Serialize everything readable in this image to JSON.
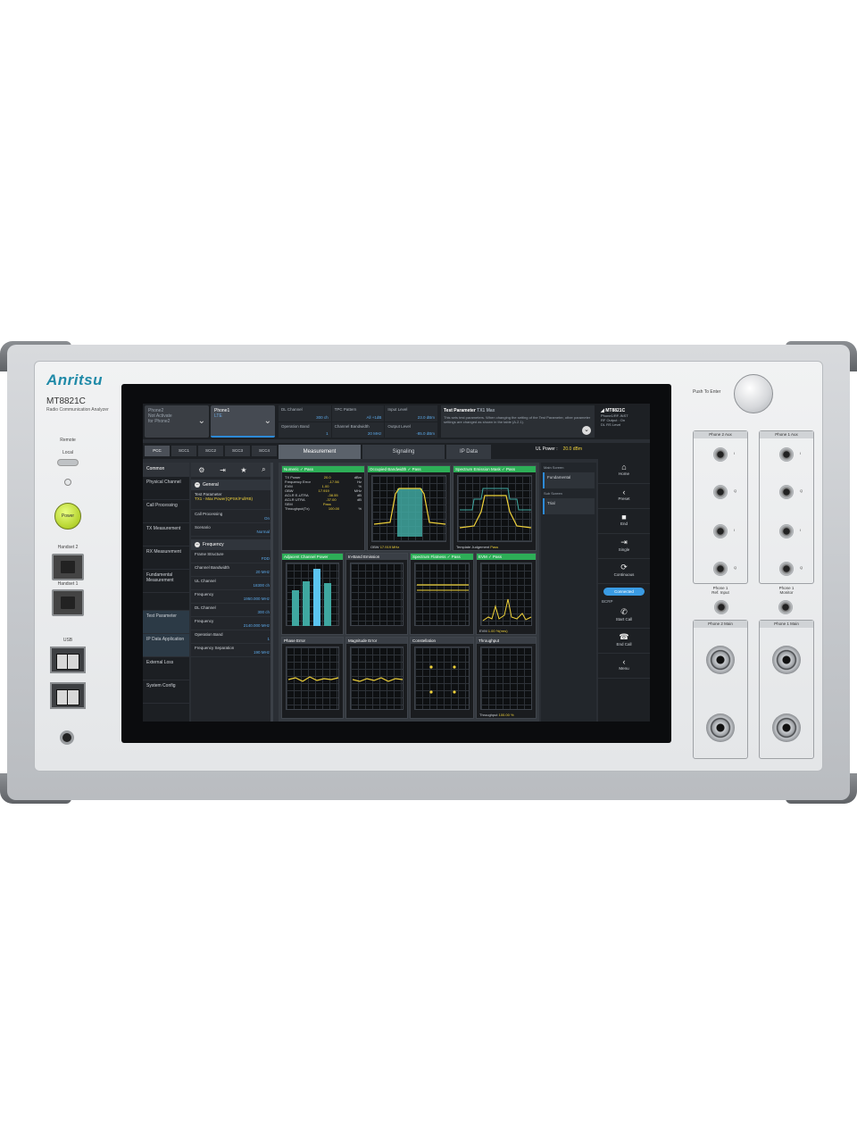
{
  "device": {
    "brand": "Anritsu",
    "model": "MT8821C",
    "subtitle": "Radio Communication Analyzer",
    "remote_label": "Remote",
    "local_label": "Local",
    "power_label": "Power",
    "handset1_label": "Handset 1",
    "handset2_label": "Handset 2",
    "usb_label": "USB",
    "knob_label": "Push To\nEnter"
  },
  "screen": {
    "phones": [
      {
        "name": "Phone2",
        "sub1": "Not Activate",
        "sub2": "for Phone2"
      },
      {
        "name": "Phone1",
        "sub1": "LTE",
        "sub2": ""
      }
    ],
    "params": [
      {
        "label": "DL Channel",
        "value": "300 ch"
      },
      {
        "label": "TPC Pattern",
        "value": "All +1dB"
      },
      {
        "label": "Input Level",
        "value": "23.0 dBm"
      },
      {
        "label": "Operation Band",
        "value": "1"
      },
      {
        "label": "Channel Bandwidth",
        "value": "20 MHz"
      },
      {
        "label": "Output Level",
        "value": "-85.0 dBm"
      }
    ],
    "test_param": {
      "title": "Test Parameter",
      "name": "TX1 Max",
      "desc": "This sets test parameters. When changing the setting of the Test Parameter, other parameter settings are changed as shown in the table (A.2.1)."
    },
    "instrument": {
      "title": "MT8821C",
      "lines": [
        "Phone1/RF-INST",
        "RF Output : On",
        "DL RS Level"
      ]
    },
    "cc_tabs": [
      "PCC",
      "SCC1",
      "SCC2",
      "SCC3",
      "SCC4"
    ],
    "main_tabs": [
      "Measurement",
      "Signaling",
      "IP Data"
    ],
    "ul_power": {
      "label": "UL Power :",
      "value": "20.0 dBm"
    },
    "left_nav": {
      "header": "Common",
      "items": [
        "Physical Channel",
        "Call Processing",
        "TX Measurement",
        "RX Measurement",
        "Fundamental Measurement",
        "",
        "Test Parameter",
        "IP Data Application",
        "External Loss",
        "System Config"
      ]
    },
    "settings": {
      "icons": [
        "wrench-icon",
        "import-icon",
        "star-icon",
        "search-icon"
      ],
      "general": {
        "title": "General",
        "rows": [
          {
            "label": "Test Parameter",
            "value": "TX1 - Max Power(QPSK/FullRB)",
            "highlight": true
          },
          {
            "label": "Call Processing",
            "value": "On",
            "highlight": false
          },
          {
            "label": "Scenario",
            "value": "Normal",
            "highlight": false
          }
        ]
      },
      "frequency": {
        "title": "Frequency",
        "rows": [
          {
            "label": "Frame Structure",
            "value": "FDD"
          },
          {
            "label": "Channel Bandwidth",
            "value": "20 MHz"
          },
          {
            "label": "UL Channel",
            "value": "18300 ch"
          },
          {
            "label": "Frequency",
            "value": "1950.000 MHz"
          },
          {
            "label": "DL Channel",
            "value": "300 ch"
          },
          {
            "label": "Frequency",
            "value": "2140.000 MHz"
          },
          {
            "label": "Operation Band",
            "value": "1"
          },
          {
            "label": "Frequency Separation",
            "value": "190 MHz"
          }
        ]
      }
    },
    "panels": [
      {
        "title": "Numeric",
        "status": "✓ Pass",
        "green": true
      },
      {
        "title": "Occupied Bandwidth",
        "status": "✓ Pass",
        "green": true,
        "footer": "OBW",
        "footer_value": "17.919 MHz"
      },
      {
        "title": "Spectrum Emission Mask",
        "status": "✓ Pass",
        "green": true,
        "footer": "Template Judgement",
        "footer_value": "Pass"
      },
      {
        "title": "Adjacent Channel Power",
        "status": "✓ Pass",
        "green": true
      },
      {
        "title": "In-Band Emission",
        "status": "",
        "green": false
      },
      {
        "title": "Spectrum Flatness",
        "status": "✓ Pass",
        "green": true
      },
      {
        "title": "EVM",
        "status": "✓ Pass",
        "green": true,
        "footer": "EVM",
        "footer_value": "1.00 %(rms)"
      },
      {
        "title": "Phase Error",
        "status": "",
        "green": false
      },
      {
        "title": "Magnitude Error",
        "status": "",
        "green": false
      },
      {
        "title": "Constellation",
        "status": "",
        "green": false
      },
      {
        "title": "Throughput",
        "status": "",
        "green": false,
        "footer": "Throughput",
        "footer_value": "100.00 %"
      }
    ],
    "numeric_table": [
      [
        "TX Power",
        "20.0",
        "dBm"
      ],
      [
        "Frequency Error",
        "-17.56",
        "Hz"
      ],
      [
        "EVM",
        "1.00",
        "%"
      ],
      [
        "OBW",
        "17.919",
        "MHz"
      ],
      [
        "ACLR E-UTRA",
        "-38.55",
        "dB"
      ],
      [
        "ACLR UTRA",
        "-37.00",
        "dB"
      ],
      [
        "SEM",
        "Pass",
        ""
      ],
      [
        "Throughput(Tx)",
        "100.00",
        "%"
      ]
    ],
    "sub_panel": {
      "main_label": "Main Screen",
      "main_item": "Fundamental",
      "sub_label": "Sub Screen",
      "sub_item": "Trial"
    },
    "right_menu": [
      {
        "icon": "home-icon",
        "label": "Home"
      },
      {
        "icon": "preset-icon",
        "label": "Preset"
      },
      {
        "icon": "end-icon",
        "label": "End"
      },
      {
        "icon": "single-icon",
        "label": "Single"
      },
      {
        "icon": "continuous-icon",
        "label": "Continuous"
      },
      {
        "icon": "pill",
        "label": "Connected"
      },
      {
        "icon": "phone-icon",
        "label": "Start Call"
      },
      {
        "icon": "end-call-icon",
        "label": "End Call"
      },
      {
        "icon": "menu-icon",
        "label": "Menu"
      }
    ],
    "bcrp": "BCRP"
  },
  "hardware": {
    "iq_left_header": "Phone 2 Aux",
    "iq_right_header": "Phone 1 Aux",
    "rf_left_header": "Phone 2 Main",
    "rf_right_header": "Phone 1 Main",
    "ref_left": "Phone 1\nRef. Input",
    "ref_right": "Phone 1\nMonitor",
    "conn_labels": [
      "I",
      "Q",
      "I",
      "Q"
    ]
  }
}
